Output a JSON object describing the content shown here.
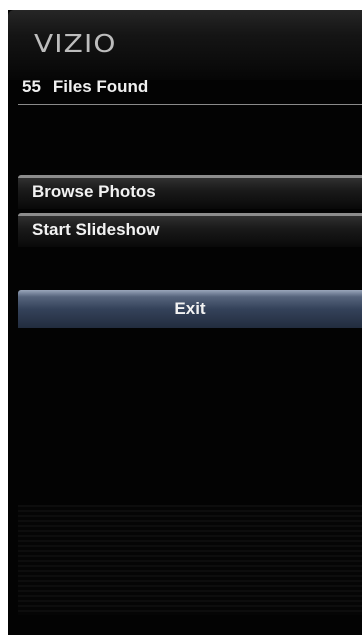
{
  "brand": {
    "logo_text": "VIZIO"
  },
  "status": {
    "file_count": "55",
    "files_found_label": "Files Found"
  },
  "menu": {
    "items": [
      {
        "label": "Browse Photos"
      },
      {
        "label": "Start Slideshow"
      }
    ],
    "exit_label": "Exit"
  },
  "colors": {
    "background": "#030303",
    "text": "#f0f0f0",
    "exit_button": "#34425a",
    "logo": "#bdbdbd"
  }
}
